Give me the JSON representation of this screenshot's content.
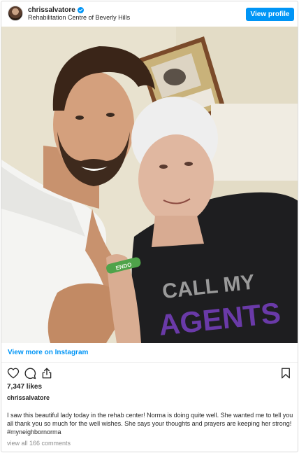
{
  "header": {
    "username": "chrissalvatore",
    "location": "Rehabilitation Centre of Beverly Hills",
    "view_profile_label": "View profile"
  },
  "photo": {
    "shirt_text_top": "CALL MY",
    "shirt_text_bottom": "AGENTS",
    "wristband_text": "ENDO"
  },
  "view_more_label": "View more on Instagram",
  "actions": {
    "icons": [
      "heart-icon",
      "comment-icon",
      "share-icon",
      "bookmark-icon"
    ]
  },
  "likes": "7,347 likes",
  "caption_username": "chrissalvatore",
  "caption": "I saw this beautiful lady today in the rehab center! Norma is doing quite well. She wanted me to tell you all thank you so much for the well wishes. She says your thoughts and prayers are keeping her strong! #myneighbornorma",
  "comments_link": "view all 166 comments",
  "colors": {
    "accent": "#0095f6",
    "text": "#262626",
    "muted": "#8e8e8e",
    "shirt_text_purple": "#6a3aa8",
    "shirt_text_grey": "#9a9a9a"
  }
}
